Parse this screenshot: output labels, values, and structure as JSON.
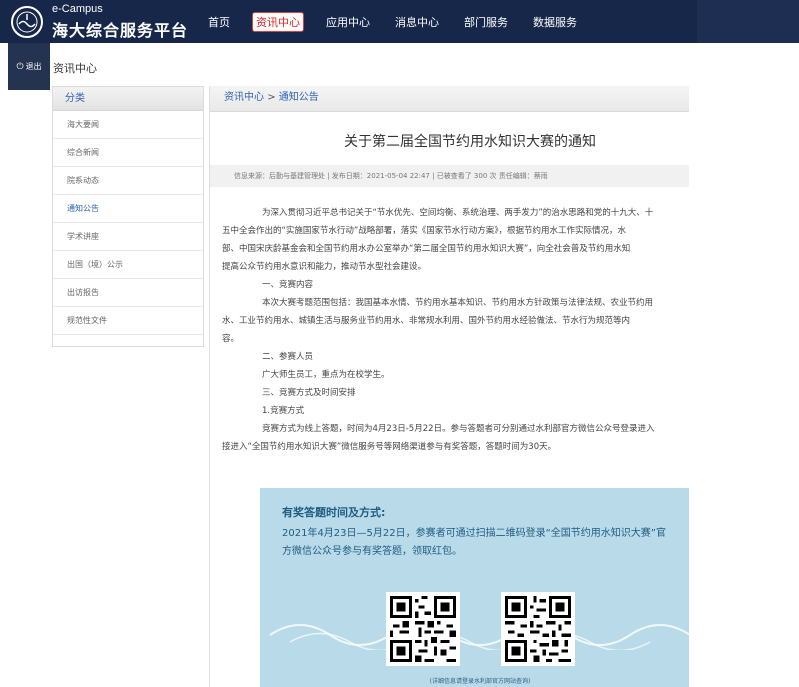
{
  "brand": {
    "en": "e-Campus",
    "cn": "海大综合服务平台"
  },
  "nav": [
    "首页",
    "资讯中心",
    "应用中心",
    "消息中心",
    "部门服务",
    "数据服务"
  ],
  "nav_active_index": 1,
  "logout": {
    "label": "退出",
    "icon": "power-icon"
  },
  "page_label": "资讯中心",
  "sidebar": {
    "heading": "分类",
    "items": [
      "海大要闻",
      "综合新闻",
      "院系动态",
      "通知公告",
      "学术讲座",
      "出国（境）公示",
      "出访报告",
      "规范性文件"
    ],
    "current_index": 3
  },
  "breadcrumb": {
    "root": "资讯中心",
    "sep": ">",
    "current": "通知公告"
  },
  "article": {
    "title": "关于第二届全国节约用水知识大赛的通知",
    "meta": "信息来源：后勤与基建管理处 | 发布日期：2021-05-04 22:47 | 已被查看了 300 次      责任编辑：蔡雨",
    "paragraphs": [
      "为深入贯彻习近平总书记关于“节水优先、空间均衡、系统治理、两手发力”的治水思路和党的十九大、十",
      "五中全会作出的“实施国家节水行动”战略部署，落实《国家节水行动方案》，根据节约用水工作实际情况，水",
      "部、中国宋庆龄基金会和全国节约用水办公室举办“第二届全国节约用水知识大赛”，向全社会普及节约用水知",
      "提高公众节约用水意识和能力，推动节水型社会建设。",
      "一、竞赛内容",
      "本次大赛考题范围包括：我国基本水情、节约用水基本知识、节约用水方针政策与法律法规、农业节约用",
      "水、工业节约用水、城镇生活与服务业节约用水、非常规水利用、国外节约用水经验做法、节水行为规范等内",
      "容。",
      "二、参赛人员",
      "广大师生员工，重点为在校学生。",
      "三、竞赛方式及时间安排",
      "1.竞赛方式",
      "竞赛方式为线上答题，时间为4月23日-5月22日。参与答题者可分别通过水利部官方微信公众号登录进入",
      "接进入“全国节约用水知识大赛”微信服务号等网络渠道参与有奖答题，答题时间为30天。"
    ]
  },
  "poster": {
    "heading": "有奖答题时间及方式:",
    "lines": [
      "2021年4月23日—5月22日，参赛者可通过扫描二维码登录“全国节约用水知识大赛”官",
      "方微信公众号参与有奖答题，领取红包。"
    ],
    "note": "(详细信息请登录水利部官方网站查询)"
  },
  "colors": {
    "topbar": "#16274a",
    "accent": "#2d62b5",
    "active": "#e02020",
    "poster": "#b9dbe9"
  }
}
